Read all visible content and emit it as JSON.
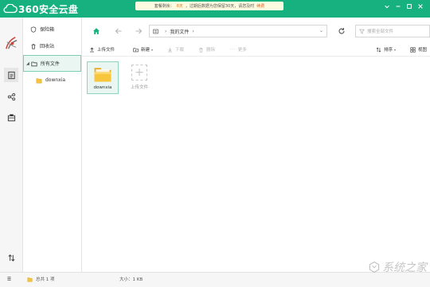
{
  "app": {
    "title": "360安全云盘",
    "accent": "#17b07f"
  },
  "notice": {
    "prefix": "套餐剩余：",
    "days": "8天",
    "text": "，过期后数据为您保留30天，请您及时",
    "link": "续费"
  },
  "window_controls": [
    "dropdown-icon",
    "minimize-icon",
    "maximize-icon",
    "close-icon"
  ],
  "rail": {
    "items": [
      {
        "icon": "file-list-icon",
        "selected": true
      },
      {
        "icon": "share-icon",
        "selected": false
      },
      {
        "icon": "toolbox-icon",
        "selected": false
      },
      {
        "icon": "transfer-icon",
        "selected": false
      },
      {
        "icon": "menu-icon",
        "selected": false
      }
    ]
  },
  "tree": {
    "items": [
      {
        "label": "保险箱",
        "icon": "shield-icon"
      },
      {
        "label": "回收站",
        "icon": "trash-icon"
      },
      {
        "label": "所有文件",
        "icon": "folder-icon",
        "selected": true,
        "expanded": true
      },
      {
        "label": "downxia",
        "icon": "folder-icon",
        "child": true
      }
    ]
  },
  "nav": {
    "breadcrumb": "我的文件",
    "search_placeholder": "搜索全部文件"
  },
  "toolbar": {
    "upload": "上传文件",
    "new": "新建",
    "download": "下载",
    "delete": "删除",
    "more": "更多",
    "sort": "排序",
    "view": "视图"
  },
  "files": [
    {
      "name": "downxia",
      "type": "folder"
    }
  ],
  "upload_tile": {
    "label": "上传文件"
  },
  "status": {
    "count": "总共 1 项",
    "size": "大小：1 KB"
  },
  "watermark": "系统之家"
}
